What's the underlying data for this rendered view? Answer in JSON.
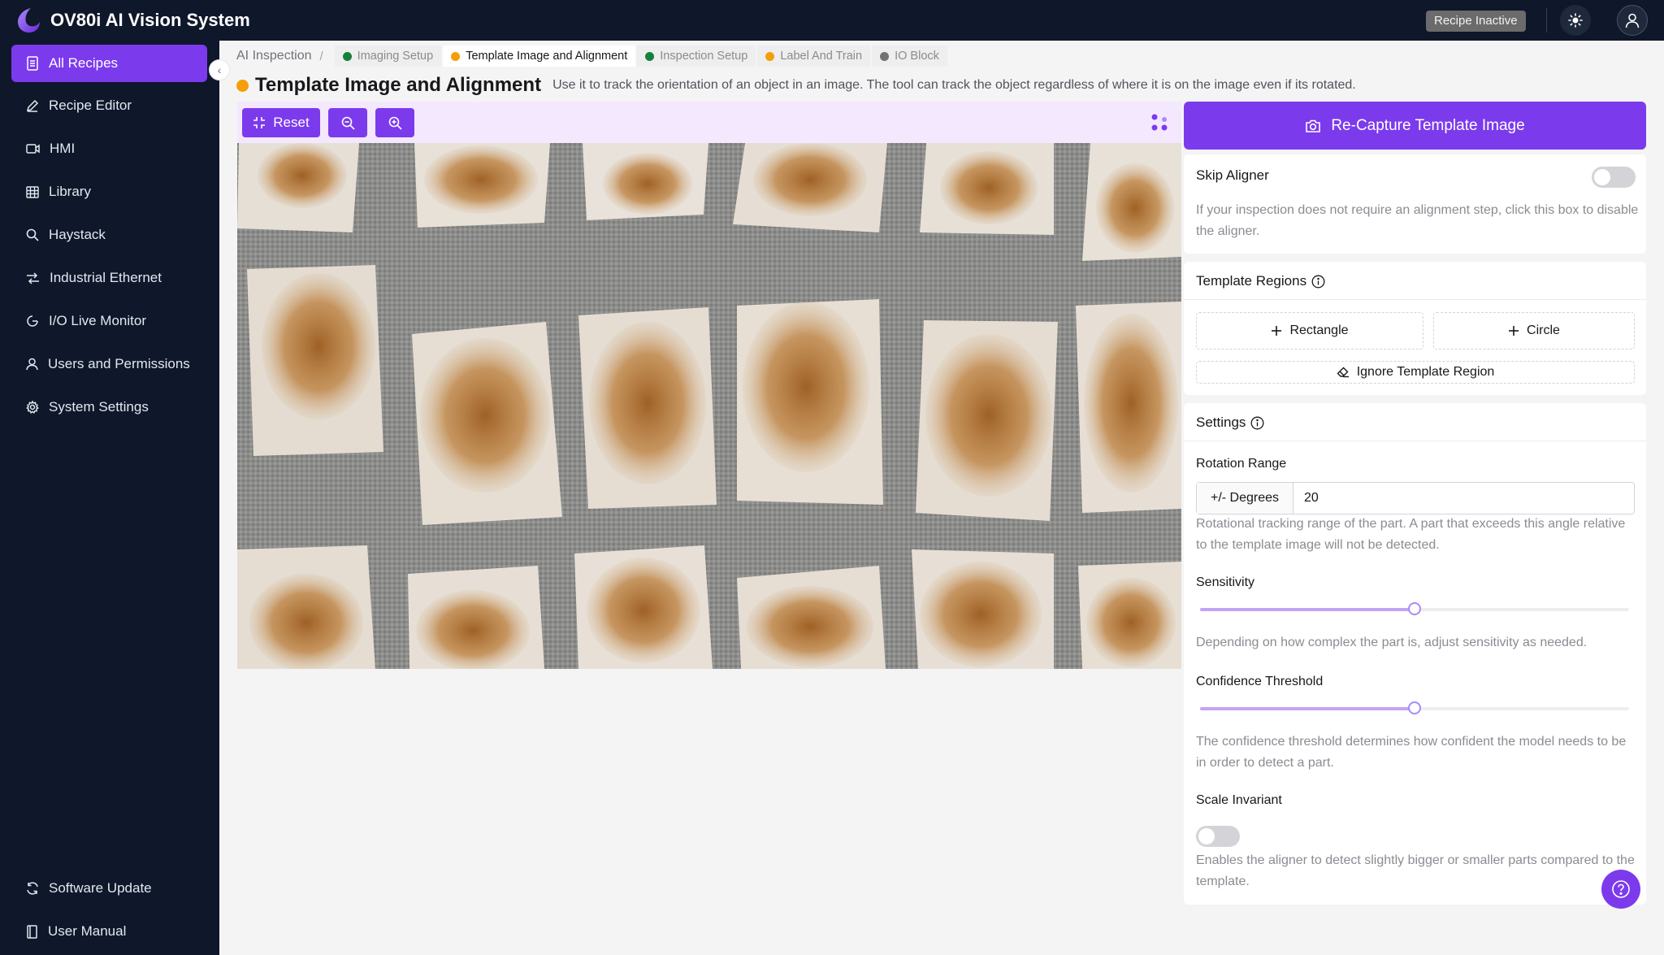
{
  "app": {
    "title": "OV80i AI Vision System",
    "status_badge": "Recipe Inactive"
  },
  "sidebar": {
    "items": [
      {
        "label": "All Recipes",
        "icon": "document-icon",
        "active": true
      },
      {
        "label": "Recipe Editor",
        "icon": "pencil-icon"
      },
      {
        "label": "HMI",
        "icon": "video-icon"
      },
      {
        "label": "Library",
        "icon": "table-icon"
      },
      {
        "label": "Haystack",
        "icon": "search-icon"
      },
      {
        "label": "Industrial Ethernet",
        "icon": "network-icon"
      },
      {
        "label": "I/O Live Monitor",
        "icon": "monitor-icon"
      },
      {
        "label": "Users and Permissions",
        "icon": "user-icon"
      },
      {
        "label": "System Settings",
        "icon": "gear-icon"
      }
    ],
    "bottom": [
      {
        "label": "Software Update",
        "icon": "refresh-icon"
      },
      {
        "label": "User Manual",
        "icon": "book-icon"
      }
    ]
  },
  "breadcrumb": {
    "root": "AI Inspection",
    "separator": "/",
    "tabs": [
      {
        "label": "Imaging Setup",
        "color": "#15803d"
      },
      {
        "label": "Template Image and Alignment",
        "color": "#f59e0b",
        "current": true
      },
      {
        "label": "Inspection Setup",
        "color": "#15803d"
      },
      {
        "label": "Label And Train",
        "color": "#f59e0b"
      },
      {
        "label": "IO Block",
        "color": "#737373"
      }
    ]
  },
  "header": {
    "status_color": "#f59e0b",
    "title": "Template Image and Alignment",
    "description": "Use it to track the orientation of an object in an image. The tool can track the object regardless of where it is on the image even if its rotated."
  },
  "toolbar": {
    "reset_label": "Reset"
  },
  "right_panel": {
    "recapture_label": "Re-Capture Template Image",
    "skip_aligner": {
      "title": "Skip Aligner",
      "enabled": false,
      "help": "If your inspection does not require an alignment step, click this box to disable the aligner."
    },
    "template_regions": {
      "title": "Template Regions",
      "rectangle_label": "Rectangle",
      "circle_label": "Circle",
      "ignore_label": "Ignore Template Region"
    },
    "settings": {
      "title": "Settings",
      "rotation_label": "Rotation Range",
      "rotation_unit": "+/- Degrees",
      "rotation_value": "20",
      "rotation_help": "Rotational tracking range of the part. A part that exceeds this angle relative to the template image will not be detected.",
      "sensitivity_label": "Sensitivity",
      "sensitivity_value": 0.5,
      "sensitivity_help": "Depending on how complex the part is, adjust sensitivity as needed.",
      "confidence_label": "Confidence Threshold",
      "confidence_value": 0.5,
      "confidence_help": "The confidence threshold determines how confident the model needs to be in order to detect a part.",
      "scale_label": "Scale Invariant",
      "scale_enabled": false,
      "scale_help": "Enables the aligner to detect slightly bigger or smaller parts compared to the template."
    }
  },
  "colors": {
    "accent": "#7c3aed",
    "sidebar_bg": "#0f172a"
  }
}
